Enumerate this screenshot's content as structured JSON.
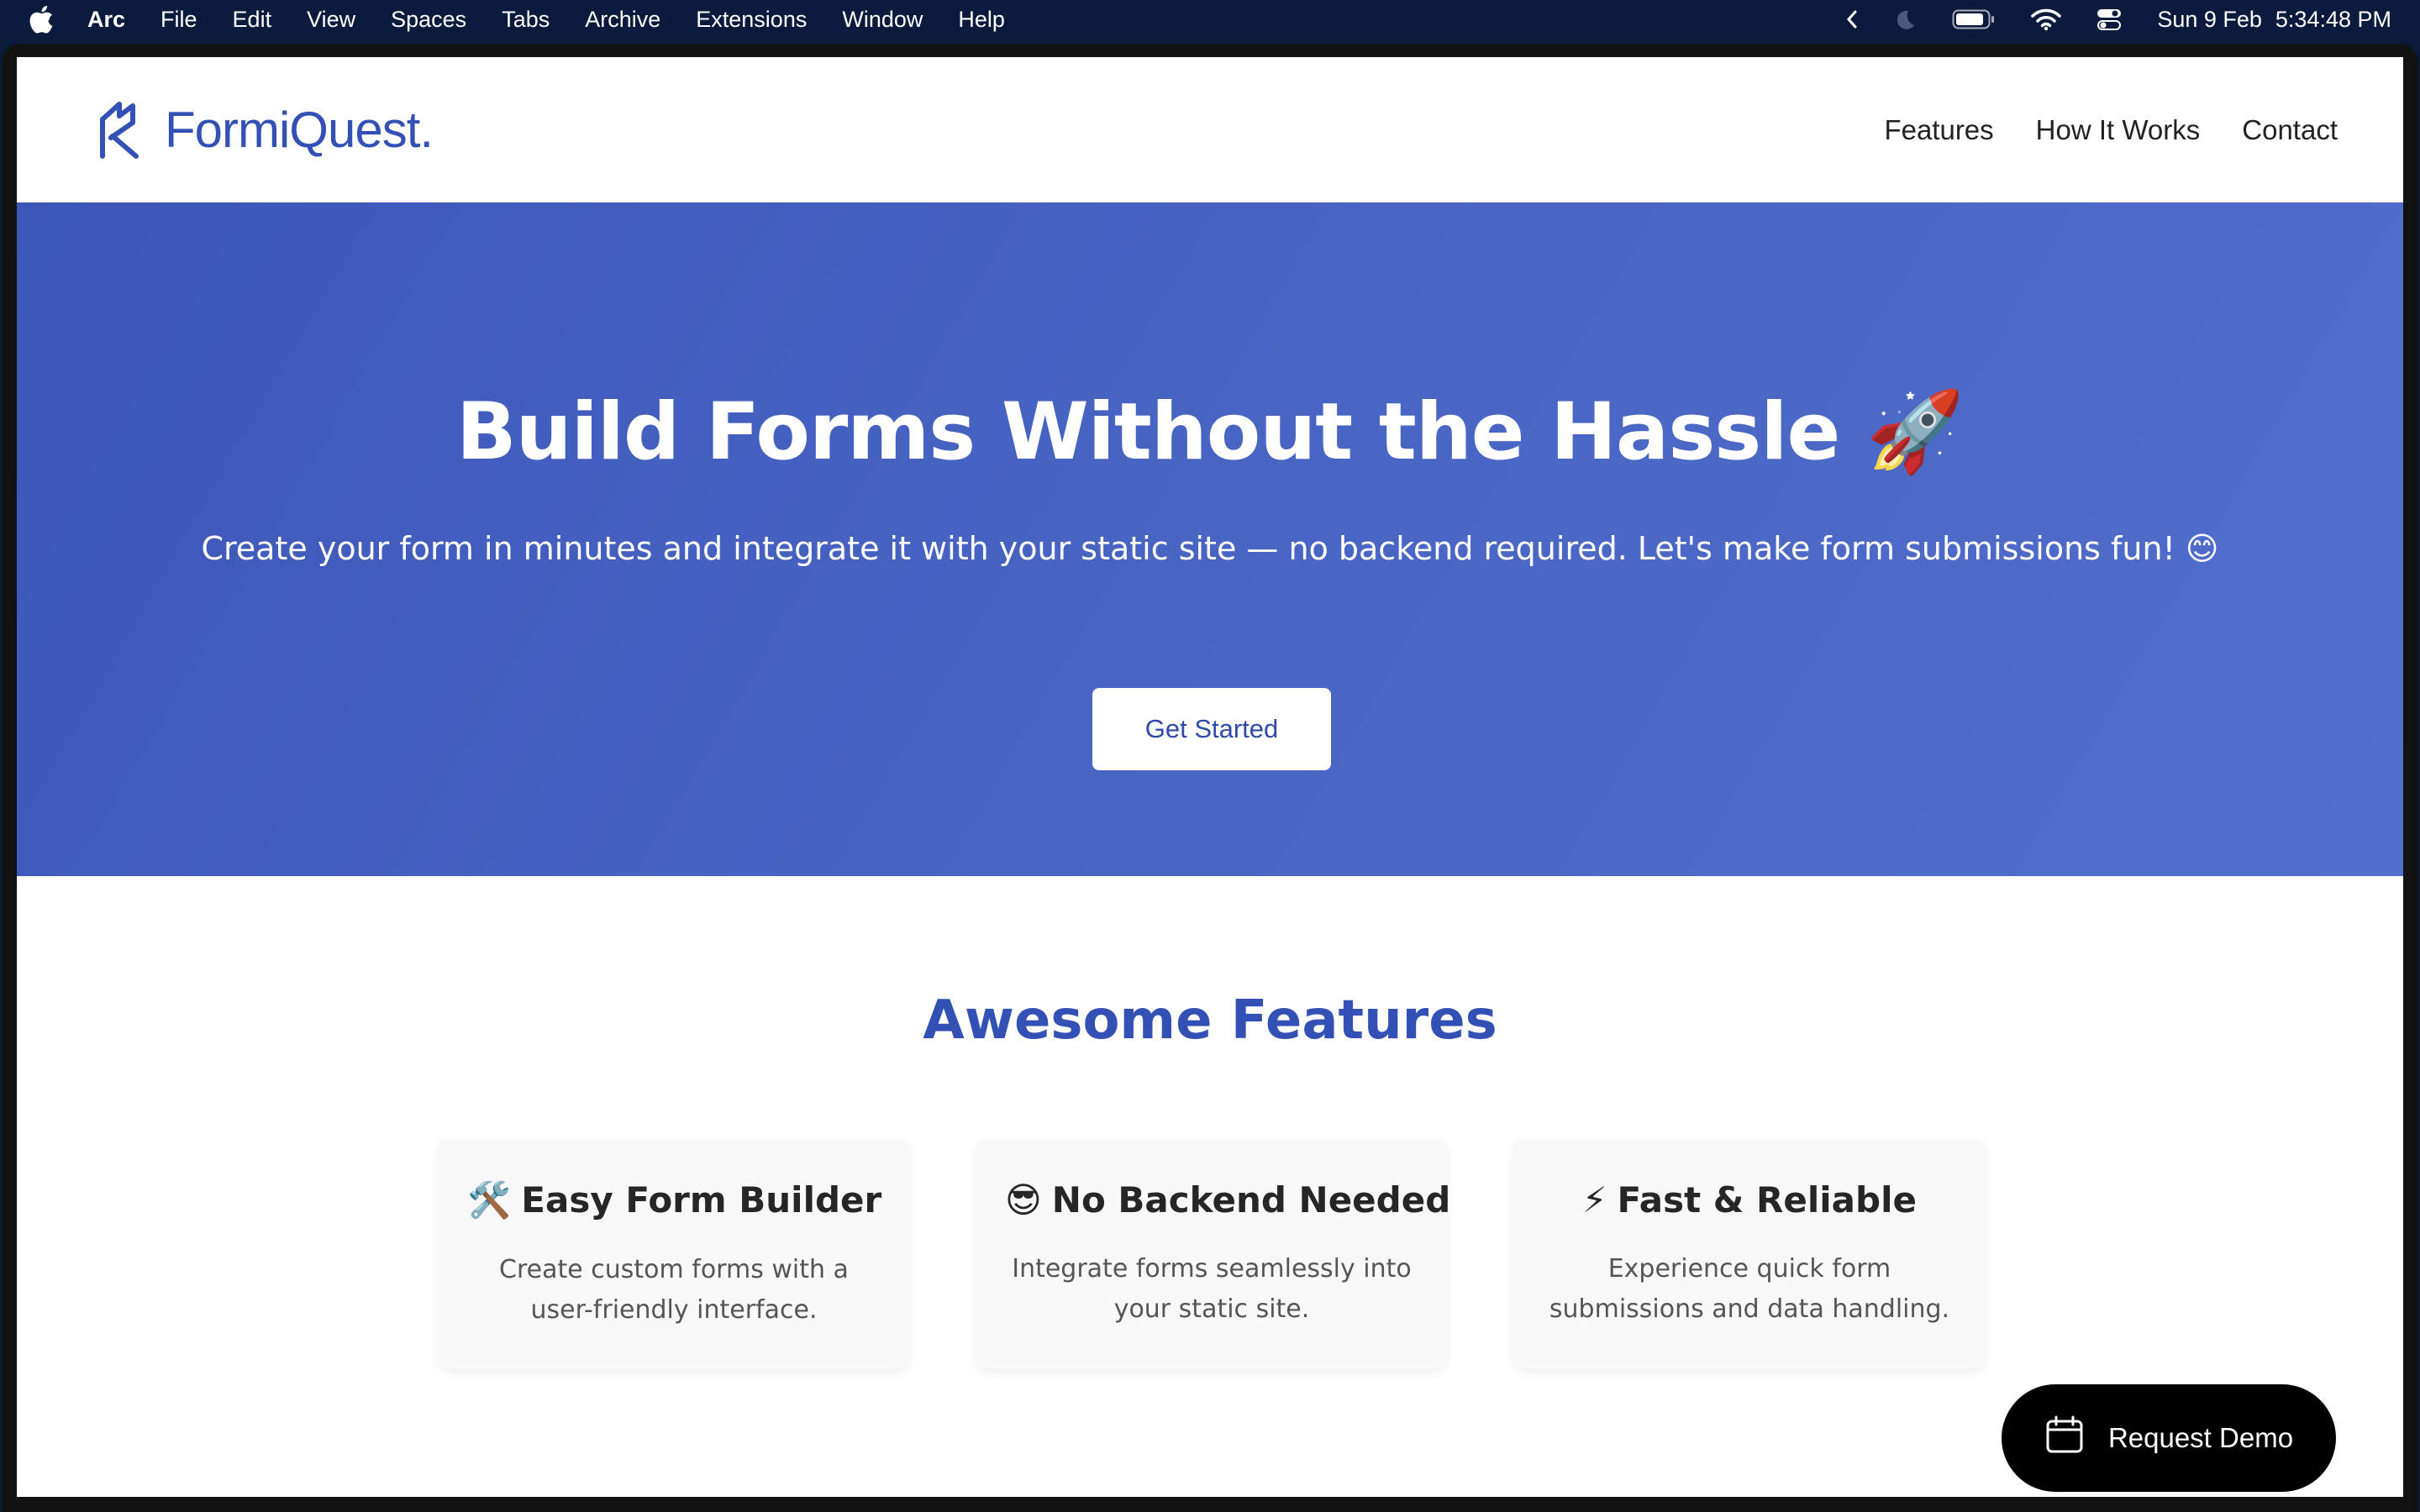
{
  "menubar": {
    "app_name": "Arc",
    "items": [
      "File",
      "Edit",
      "View",
      "Spaces",
      "Tabs",
      "Archive",
      "Extensions",
      "Window",
      "Help"
    ],
    "date": "Sun 9 Feb",
    "time": "5:34:48 PM"
  },
  "header": {
    "logo_text": "FormiQuest.",
    "nav": [
      "Features",
      "How It Works",
      "Contact"
    ]
  },
  "hero": {
    "title": "Build Forms Without the Hassle 🚀",
    "subtitle": "Create your form in minutes and integrate it with your static site — no backend required. Let's make form submissions fun! 😊",
    "cta_label": "Get Started"
  },
  "features": {
    "title": "Awesome Features",
    "cards": [
      {
        "emoji": "🛠️",
        "title": "Easy Form Builder",
        "desc": "Create custom forms with a user-friendly interface."
      },
      {
        "emoji": "😎",
        "title": "No Backend Needed",
        "desc": "Integrate forms seamlessly into your static site."
      },
      {
        "emoji": "⚡",
        "title": "Fast & Reliable",
        "desc": "Experience quick form submissions and data handling."
      }
    ]
  },
  "demo_button": {
    "label": "Request Demo",
    "icon": "calendar-icon"
  },
  "colors": {
    "brand": "#3350b5",
    "hero_start": "#3c57b8",
    "hero_end": "#516ecc",
    "menubar": "#0c1b3d"
  }
}
